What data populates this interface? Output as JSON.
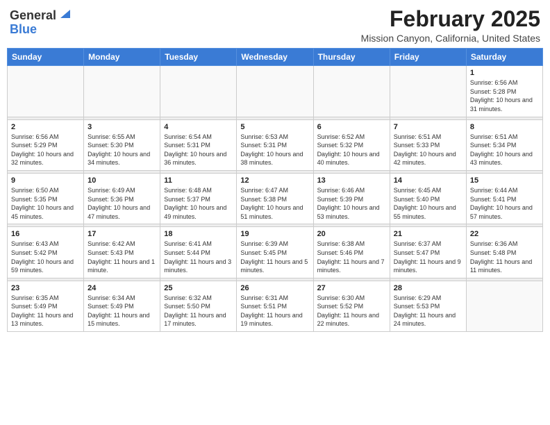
{
  "header": {
    "logo_general": "General",
    "logo_blue": "Blue",
    "month_title": "February 2025",
    "location": "Mission Canyon, California, United States"
  },
  "weekdays": [
    "Sunday",
    "Monday",
    "Tuesday",
    "Wednesday",
    "Thursday",
    "Friday",
    "Saturday"
  ],
  "weeks": [
    [
      {
        "day": "",
        "info": ""
      },
      {
        "day": "",
        "info": ""
      },
      {
        "day": "",
        "info": ""
      },
      {
        "day": "",
        "info": ""
      },
      {
        "day": "",
        "info": ""
      },
      {
        "day": "",
        "info": ""
      },
      {
        "day": "1",
        "info": "Sunrise: 6:56 AM\nSunset: 5:28 PM\nDaylight: 10 hours and 31 minutes."
      }
    ],
    [
      {
        "day": "2",
        "info": "Sunrise: 6:56 AM\nSunset: 5:29 PM\nDaylight: 10 hours and 32 minutes."
      },
      {
        "day": "3",
        "info": "Sunrise: 6:55 AM\nSunset: 5:30 PM\nDaylight: 10 hours and 34 minutes."
      },
      {
        "day": "4",
        "info": "Sunrise: 6:54 AM\nSunset: 5:31 PM\nDaylight: 10 hours and 36 minutes."
      },
      {
        "day": "5",
        "info": "Sunrise: 6:53 AM\nSunset: 5:31 PM\nDaylight: 10 hours and 38 minutes."
      },
      {
        "day": "6",
        "info": "Sunrise: 6:52 AM\nSunset: 5:32 PM\nDaylight: 10 hours and 40 minutes."
      },
      {
        "day": "7",
        "info": "Sunrise: 6:51 AM\nSunset: 5:33 PM\nDaylight: 10 hours and 42 minutes."
      },
      {
        "day": "8",
        "info": "Sunrise: 6:51 AM\nSunset: 5:34 PM\nDaylight: 10 hours and 43 minutes."
      }
    ],
    [
      {
        "day": "9",
        "info": "Sunrise: 6:50 AM\nSunset: 5:35 PM\nDaylight: 10 hours and 45 minutes."
      },
      {
        "day": "10",
        "info": "Sunrise: 6:49 AM\nSunset: 5:36 PM\nDaylight: 10 hours and 47 minutes."
      },
      {
        "day": "11",
        "info": "Sunrise: 6:48 AM\nSunset: 5:37 PM\nDaylight: 10 hours and 49 minutes."
      },
      {
        "day": "12",
        "info": "Sunrise: 6:47 AM\nSunset: 5:38 PM\nDaylight: 10 hours and 51 minutes."
      },
      {
        "day": "13",
        "info": "Sunrise: 6:46 AM\nSunset: 5:39 PM\nDaylight: 10 hours and 53 minutes."
      },
      {
        "day": "14",
        "info": "Sunrise: 6:45 AM\nSunset: 5:40 PM\nDaylight: 10 hours and 55 minutes."
      },
      {
        "day": "15",
        "info": "Sunrise: 6:44 AM\nSunset: 5:41 PM\nDaylight: 10 hours and 57 minutes."
      }
    ],
    [
      {
        "day": "16",
        "info": "Sunrise: 6:43 AM\nSunset: 5:42 PM\nDaylight: 10 hours and 59 minutes."
      },
      {
        "day": "17",
        "info": "Sunrise: 6:42 AM\nSunset: 5:43 PM\nDaylight: 11 hours and 1 minute."
      },
      {
        "day": "18",
        "info": "Sunrise: 6:41 AM\nSunset: 5:44 PM\nDaylight: 11 hours and 3 minutes."
      },
      {
        "day": "19",
        "info": "Sunrise: 6:39 AM\nSunset: 5:45 PM\nDaylight: 11 hours and 5 minutes."
      },
      {
        "day": "20",
        "info": "Sunrise: 6:38 AM\nSunset: 5:46 PM\nDaylight: 11 hours and 7 minutes."
      },
      {
        "day": "21",
        "info": "Sunrise: 6:37 AM\nSunset: 5:47 PM\nDaylight: 11 hours and 9 minutes."
      },
      {
        "day": "22",
        "info": "Sunrise: 6:36 AM\nSunset: 5:48 PM\nDaylight: 11 hours and 11 minutes."
      }
    ],
    [
      {
        "day": "23",
        "info": "Sunrise: 6:35 AM\nSunset: 5:49 PM\nDaylight: 11 hours and 13 minutes."
      },
      {
        "day": "24",
        "info": "Sunrise: 6:34 AM\nSunset: 5:49 PM\nDaylight: 11 hours and 15 minutes."
      },
      {
        "day": "25",
        "info": "Sunrise: 6:32 AM\nSunset: 5:50 PM\nDaylight: 11 hours and 17 minutes."
      },
      {
        "day": "26",
        "info": "Sunrise: 6:31 AM\nSunset: 5:51 PM\nDaylight: 11 hours and 19 minutes."
      },
      {
        "day": "27",
        "info": "Sunrise: 6:30 AM\nSunset: 5:52 PM\nDaylight: 11 hours and 22 minutes."
      },
      {
        "day": "28",
        "info": "Sunrise: 6:29 AM\nSunset: 5:53 PM\nDaylight: 11 hours and 24 minutes."
      },
      {
        "day": "",
        "info": ""
      }
    ]
  ]
}
